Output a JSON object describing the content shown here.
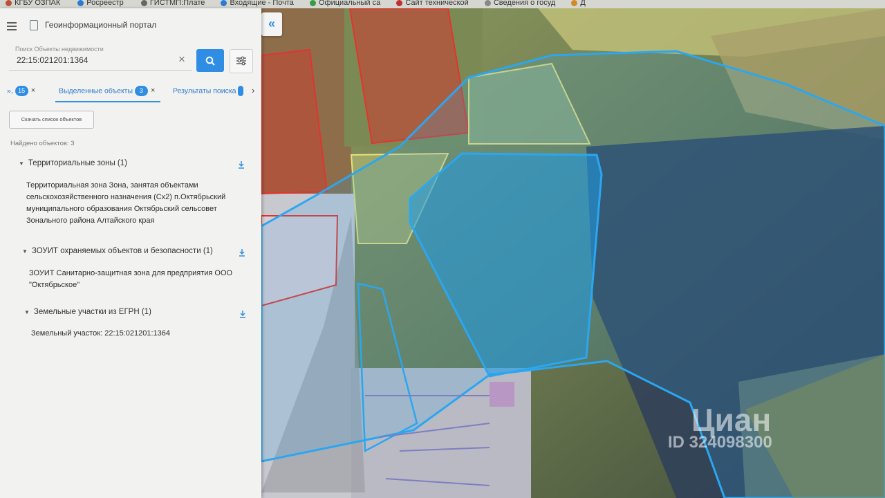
{
  "bookmarks": [
    "КГБУ ОЗПАК",
    "Росреестр",
    "ГИСТМП:Плате",
    "Входящие - Почта",
    "Официальный са",
    "Сайт технической",
    "Сведения о госуд",
    "Д"
  ],
  "app": {
    "title": "Геоинформационный портал"
  },
  "search": {
    "label": "Поиск Объекты недвижимости",
    "value": "22:15:021201:1364",
    "clear": "×"
  },
  "tabs": [
    {
      "label": "», ",
      "count": "15",
      "close": "×"
    },
    {
      "label": "Выделенные объекты",
      "count": "3",
      "close": "×"
    },
    {
      "label": "Результаты поиска",
      "count": "",
      "close": ""
    }
  ],
  "tabs_more": "›",
  "download_list": "Скачать список объектов",
  "found_text": "Найдено объектов: 3",
  "sections": [
    {
      "title": "Территориальные зоны (1)",
      "lines": [
        "Территориальная зона Зона, занятая объектами",
        "сельскохозяйственного назначения (Сх2) п.Октябрьский",
        "муниципального образования Октябрьский сельсовет",
        "Зонального района Алтайского края"
      ]
    },
    {
      "title": "ЗОУИТ охраняемых объектов и безопасности (1)",
      "lines": [
        "ЗОУИТ Санитарно-защитная зона для предприятия ООО",
        "\"Октябрьское\""
      ]
    },
    {
      "title": "Земельные участки из ЕГРН (1)",
      "lines": [
        "Земельный участок: 22:15:021201:1364"
      ]
    }
  ],
  "map": {
    "collapse": "«"
  },
  "watermark": {
    "brand": "Циан",
    "id": "ID 324098300"
  },
  "colors": {
    "accent": "#2f8ee3",
    "parcel_red": "#e2342d",
    "zone_blue": "#2aa7f0",
    "zone_yellow": "#e8e07a"
  }
}
